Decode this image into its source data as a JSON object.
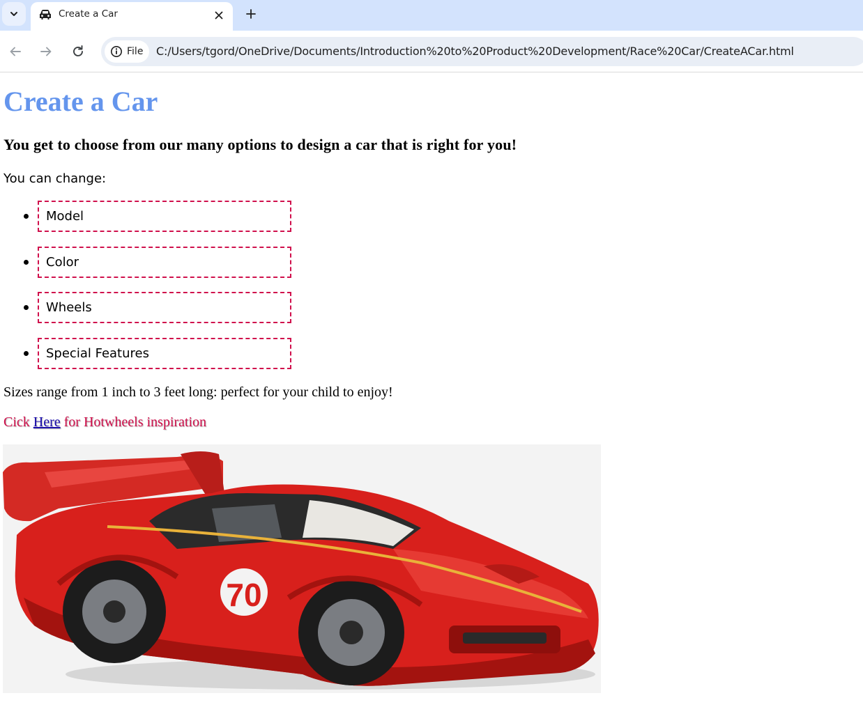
{
  "browser": {
    "tab_title": "Create a Car",
    "site_info_label": "File",
    "url": "C:/Users/tgord/OneDrive/Documents/Introduction%20to%20Product%20Development/Race%20Car/CreateACar.html"
  },
  "page": {
    "title": "Create a Car",
    "subtitle": "You get to choose from our many options to design a car that is right for you!",
    "intro": "You can change:",
    "options": [
      {
        "label": "Model"
      },
      {
        "label": "Color"
      },
      {
        "label": "Wheels"
      },
      {
        "label": "Special Features"
      }
    ],
    "sizes_text": "Sizes range from 1 inch to 3 feet long: perfect for your child to enjoy!",
    "inspiration": {
      "before": "Cick ",
      "link_text": "Here",
      "after": " for Hotwheels inspiration"
    },
    "car_number": "70"
  },
  "colors": {
    "title": "#6495ed",
    "accent": "#d0104c",
    "link": "#1a0dab",
    "car_body": "#d8201c",
    "tab_strip": "#d3e3fd",
    "omnibox": "#e9eef6"
  },
  "icons": {
    "tab_search": "chevron-down-icon",
    "favicon": "car-icon",
    "close": "close-icon",
    "new_tab": "plus-icon",
    "back": "arrow-left-icon",
    "forward": "arrow-right-icon",
    "reload": "reload-icon",
    "site_info": "info-icon"
  }
}
